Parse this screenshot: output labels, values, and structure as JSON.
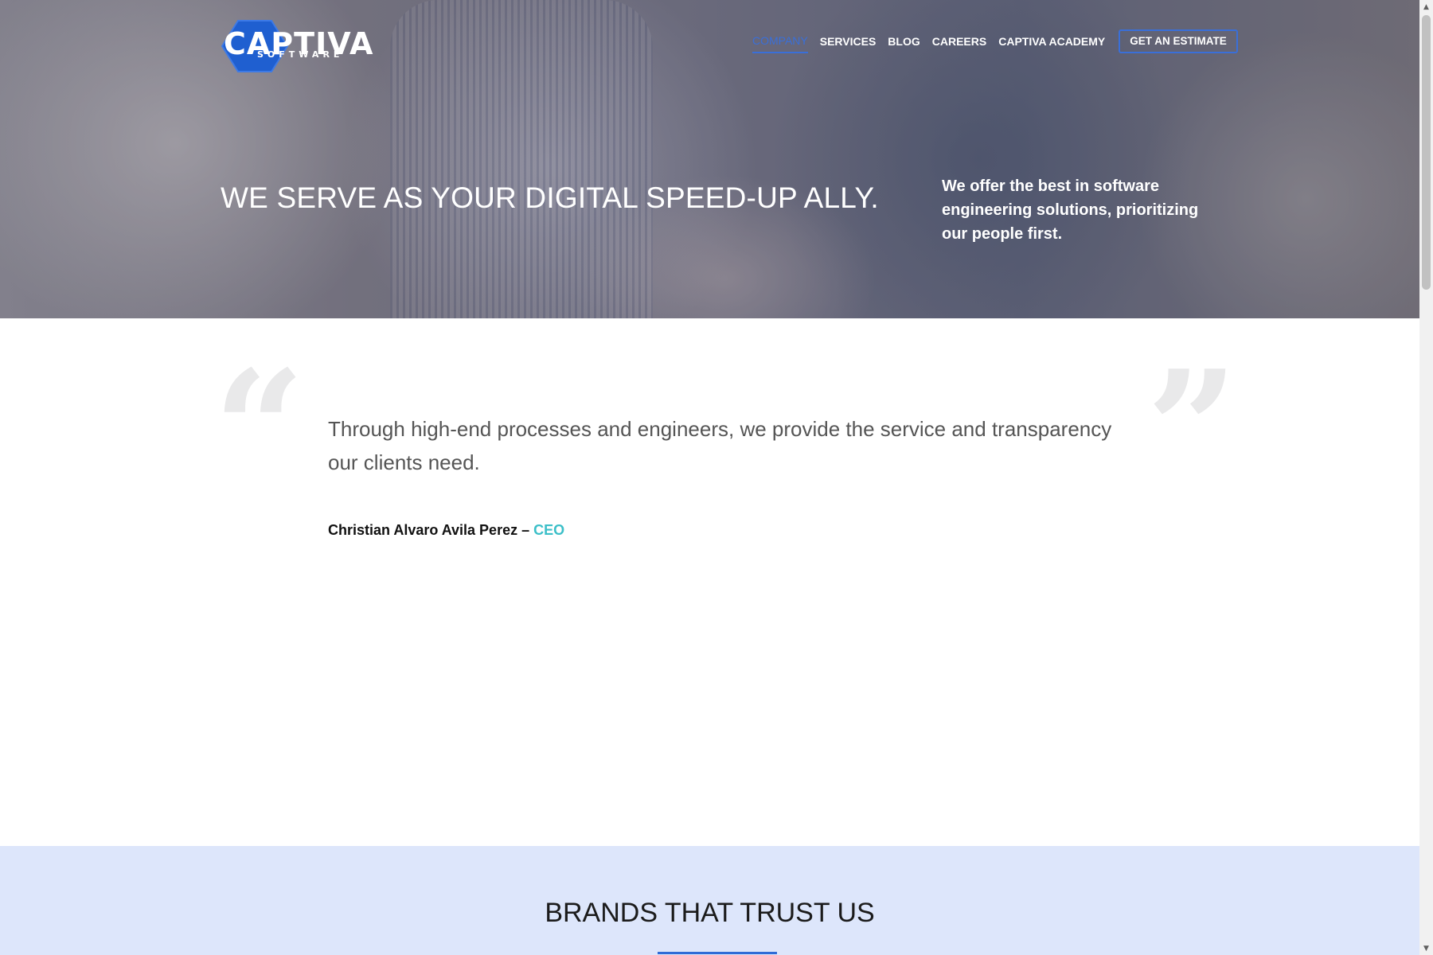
{
  "brand": {
    "logo_text": "CAPTIVA",
    "logo_subtext": "SOFTWARE",
    "accent_color": "#3a6fd8",
    "logo_color": "#1f5fd0"
  },
  "nav": {
    "items": [
      {
        "label": "COMPANY",
        "active": true
      },
      {
        "label": "SERVICES"
      },
      {
        "label": "BLOG"
      },
      {
        "label": "CAREERS"
      },
      {
        "label": "CAPTIVA ACADEMY"
      }
    ],
    "cta_label": "GET AN ESTIMATE"
  },
  "hero": {
    "title": "WE SERVE AS YOUR DIGITAL SPEED-UP ALLY.",
    "subtitle": "We offer the best in software engineering solutions, prioritizing our people first."
  },
  "quote": {
    "open_mark": "“",
    "close_mark": "”",
    "text": "Through high-end processes and engineers, we provide the service and transparency our clients need.",
    "author_name": "Christian Alvaro Avila Perez",
    "separator": " – ",
    "author_role": "CEO"
  },
  "brands": {
    "title": "BRANDS THAT TRUST US",
    "background": "#dde6fb"
  },
  "scrollbar": {
    "up_icon": "▲",
    "down_icon": "▼"
  }
}
